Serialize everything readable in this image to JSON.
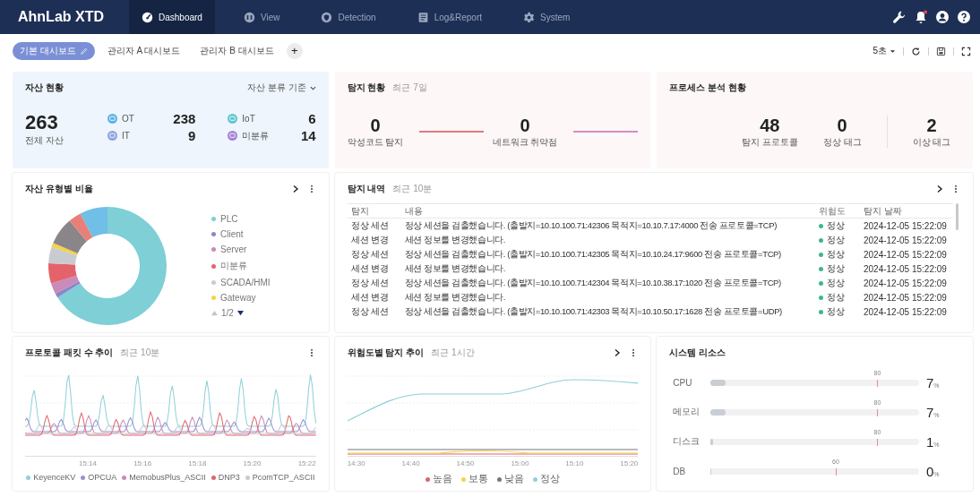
{
  "nav": {
    "brand": "AhnLab XTD",
    "tabs": [
      {
        "label": "Dashboard",
        "selected": true
      },
      {
        "label": "View",
        "selected": false
      },
      {
        "label": "Detection",
        "selected": false
      },
      {
        "label": "Log&Report",
        "selected": false
      },
      {
        "label": "System",
        "selected": false
      }
    ]
  },
  "dashboards": {
    "tabs": [
      {
        "label": "기본 대시보드",
        "selected": true
      },
      {
        "label": "관리자 A 대시보드",
        "selected": false
      },
      {
        "label": "관리자 B 대시보드",
        "selected": false
      }
    ],
    "add_button": "+",
    "interval": "5초"
  },
  "assets": {
    "title": "자산 현황",
    "filter": "자산 분류 기준",
    "total": "263",
    "total_label": "전체 자산",
    "groups": [
      {
        "label": "OT",
        "count": "238",
        "color": "#5fb3e3"
      },
      {
        "label": "IoT",
        "count": "6",
        "color": "#5fc7cf"
      },
      {
        "label": "IT",
        "count": "9",
        "color": "#8ea4e0"
      },
      {
        "label": "미분류",
        "count": "14",
        "color": "#a682d6"
      }
    ]
  },
  "detection_status": {
    "title": "탐지 현황",
    "subtitle": "최근 7일",
    "items": [
      {
        "value": "0",
        "label": "악성코드 탐지",
        "color": "#e07a7e"
      },
      {
        "value": "0",
        "label": "네트워크 취약점",
        "color": "#d68cc4"
      }
    ]
  },
  "process": {
    "title": "프로세스 분석 현황",
    "items": [
      {
        "value": "48",
        "label": "탐지 프로토콜"
      },
      {
        "value": "0",
        "label": "정상 태그"
      },
      {
        "value": "2",
        "label": "이상 태그"
      }
    ]
  },
  "asset_types": {
    "title": "자산 유형별 비율",
    "legend": [
      {
        "label": "PLC",
        "color": "#7ecfd6"
      },
      {
        "label": "Client",
        "color": "#8b86c9"
      },
      {
        "label": "Server",
        "color": "#c98bb9"
      },
      {
        "label": "미분류",
        "color": "#e4636b"
      },
      {
        "label": "SCADA/HMI",
        "color": "#c8ccd0"
      },
      {
        "label": "Gateway",
        "color": "#f3d34a"
      }
    ],
    "page": "1/2"
  },
  "detections": {
    "title": "탐지 내역",
    "subtitle": "최근 10분",
    "columns": [
      "탐지",
      "내용",
      "위험도",
      "탐지 날짜"
    ],
    "rows": [
      {
        "type": "정상 세션",
        "content": "정상 세션을 검출했습니다. (출발지=10.10.100.71:42306 목적지=10.10.7.17:4000 전송 프로토콜=TCP)",
        "severity": "정상",
        "color": "#3fb68b",
        "date": "2024-12-05 15:22:09"
      },
      {
        "type": "세션 변경",
        "content": "세션 정보를 변경했습니다.",
        "severity": "정상",
        "color": "#3fb68b",
        "date": "2024-12-05 15:22:09"
      },
      {
        "type": "정상 세션",
        "content": "정상 세션을 검출했습니다. (출발지=10.10.100.71:42305 목적지=10.10.24.17:9600 전송 프로토콜=TCP)",
        "severity": "정상",
        "color": "#3fb68b",
        "date": "2024-12-05 15:22:09"
      },
      {
        "type": "세션 변경",
        "content": "세션 정보를 변경했습니다.",
        "severity": "정상",
        "color": "#3fb68b",
        "date": "2024-12-05 15:22:09"
      },
      {
        "type": "정상 세션",
        "content": "정상 세션을 검출했습니다. (출발지=10.10.100.71:42304 목적지=10.10.38.17:1020 전송 프로토콜=TCP)",
        "severity": "정상",
        "color": "#3fb68b",
        "date": "2024-12-05 15:22:09"
      },
      {
        "type": "세션 변경",
        "content": "세션 정보를 변경했습니다.",
        "severity": "정상",
        "color": "#3fb68b",
        "date": "2024-12-05 15:22:09"
      },
      {
        "type": "정상 세션",
        "content": "정상 세션을 검출했습니다. (출발지=10.10.100.71:42303 목적지=10.10.50.17:1628 전송 프로토콜=UDP)",
        "severity": "정상",
        "color": "#3fb68b",
        "date": "2024-12-05 15:22:09"
      }
    ]
  },
  "packets": {
    "title": "프로토콜 패킷 수 추이",
    "subtitle": "최근 10분",
    "x_labels": [
      "15:14",
      "15:16",
      "15:18",
      "15:20",
      "15:22"
    ],
    "legend": [
      {
        "label": "KeyenceKV",
        "color": "#8fd0d8"
      },
      {
        "label": "OPCUA",
        "color": "#9a8fd0"
      },
      {
        "label": "MemobusPlus_ASCII",
        "color": "#c98bb9"
      },
      {
        "label": "DNP3",
        "color": "#e0636b"
      },
      {
        "label": "PcomTCP_ASCII",
        "color": "#c8cacc"
      }
    ]
  },
  "severity_trend": {
    "title": "위험도별 탐지 추이",
    "subtitle": "최근 1시간",
    "x_labels": [
      "14:30",
      "14:40",
      "14:50",
      "15:00",
      "15:10",
      "15:20"
    ],
    "legend": [
      {
        "label": "높음",
        "color": "#e0636b"
      },
      {
        "label": "보통",
        "color": "#f3d34a"
      },
      {
        "label": "낮음",
        "color": "#777777"
      },
      {
        "label": "정상",
        "color": "#8fd0d8"
      }
    ]
  },
  "resources": {
    "title": "시스템 리소스",
    "items": [
      {
        "label": "CPU",
        "threshold": "80",
        "value": "7",
        "unit": "%",
        "level": 0.07
      },
      {
        "label": "메모리",
        "threshold": "80",
        "value": "7",
        "unit": "%",
        "level": 0.07
      },
      {
        "label": "디스크",
        "threshold": "80",
        "value": "1",
        "unit": "%",
        "level": 0.01
      },
      {
        "label": "DB",
        "threshold": "60",
        "value": "0",
        "unit": "%",
        "level": 0
      }
    ]
  }
}
